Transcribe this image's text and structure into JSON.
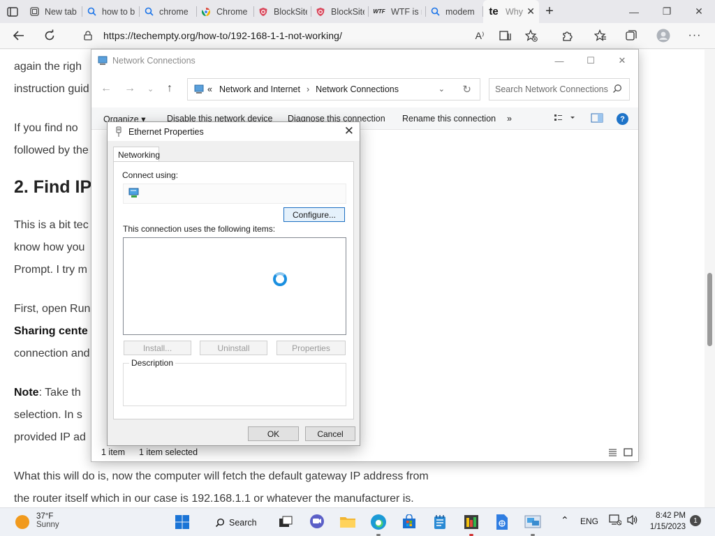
{
  "browser": {
    "tabs": [
      {
        "title": "New tab",
        "icon": "newtab-icon"
      },
      {
        "title": "how to b",
        "icon": "search-icon"
      },
      {
        "title": "chrome",
        "icon": "search-icon"
      },
      {
        "title": "Chrome",
        "icon": "chrome-icon"
      },
      {
        "title": "BlockSite",
        "icon": "blocksite-icon"
      },
      {
        "title": "BlockSite",
        "icon": "blocksite-icon"
      },
      {
        "title": "WTF is m",
        "icon": "wtf-icon"
      },
      {
        "title": "modem",
        "icon": "search-icon"
      },
      {
        "title": "Why",
        "icon": "te-icon",
        "active": true
      }
    ],
    "url": "https://techempty.org/how-to/192-168-1-1-not-working/",
    "wtf_favicon": "WTF",
    "te_favicon": "te"
  },
  "article": {
    "line1": "again the righ",
    "line2": "instruction guid",
    "line3": "If you find no",
    "line4": "followed by the",
    "heading": "2. Find IP",
    "line5": "This is a bit tec",
    "line6": "know how you",
    "line7": "Prompt. I try m",
    "line8": "First, open Run",
    "line9_bold": "Sharing cente",
    "line10": "connection and",
    "note_bold": "Note",
    "line11": ": Take th",
    "line12": "selection. In s",
    "line13": "provided IP ad",
    "line14": "What this will do is, now the computer will fetch the default gateway IP address from",
    "line15": "the router itself which in our case is 192.168.1.1 or whatever the manufacturer is."
  },
  "netwindow": {
    "title": "Network Connections",
    "breadcrumb_prefix": "«",
    "crumb1": "Network and Internet",
    "crumb2": "Network Connections",
    "search_placeholder": "Search Network Connections",
    "commands": {
      "organize": "Organize ▾",
      "disable": "Disable this network device",
      "diagnose": "Diagnose this connection",
      "rename": "Rename this connection",
      "more": "»",
      "help": "?"
    },
    "status_count": "1 item",
    "status_selected": "1 item selected"
  },
  "dialog": {
    "title": "Ethernet Properties",
    "tab": "Networking",
    "connect_using": "Connect using:",
    "configure": "Configure...",
    "items_label": "This connection uses the following items:",
    "install": "Install...",
    "uninstall": "Uninstall",
    "properties": "Properties",
    "description": "Description",
    "ok": "OK",
    "cancel": "Cancel"
  },
  "taskbar": {
    "temp": "37°F",
    "condition": "Sunny",
    "search": "Search",
    "lang": "ENG",
    "time": "8:42 PM",
    "date": "1/15/2023",
    "notifications": "1"
  }
}
